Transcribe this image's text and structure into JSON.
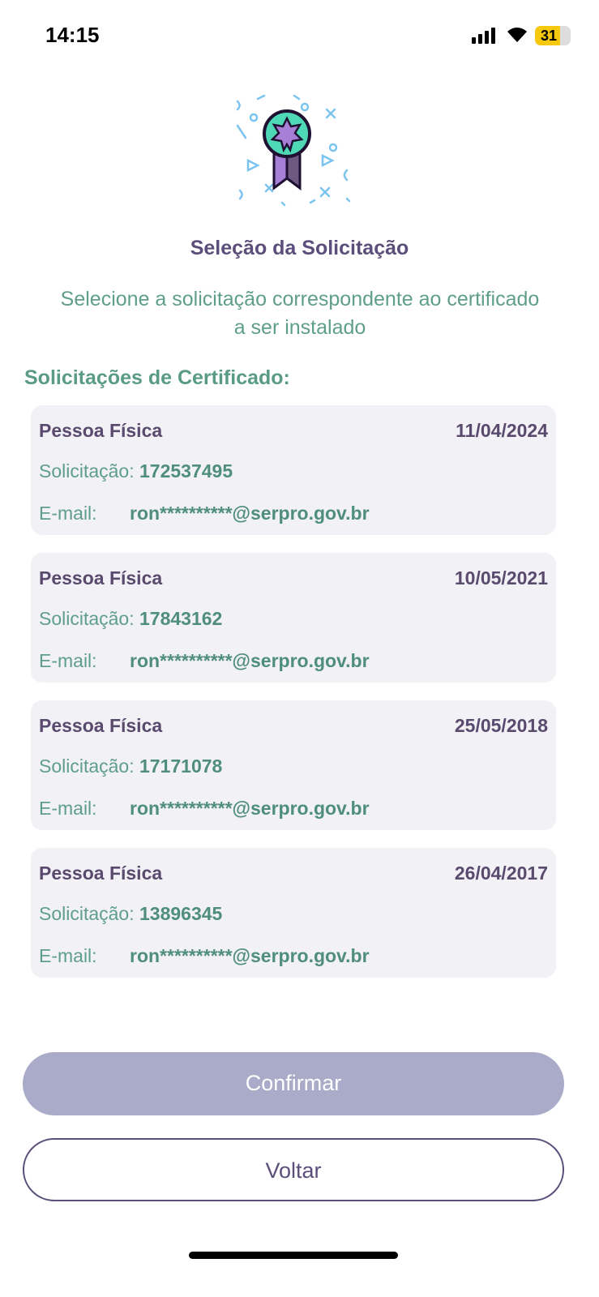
{
  "status_bar": {
    "time": "14:15",
    "battery": "31"
  },
  "header": {
    "title": "Seleção da Solicitação",
    "subtitle": "Selecione a solicitação correspondente ao certificado a ser instalado"
  },
  "section_title": "Solicitações de Certificado:",
  "labels": {
    "request": "Solicitação:",
    "email": "E-mail:"
  },
  "requests": [
    {
      "type": "Pessoa Física",
      "date": "11/04/2024",
      "number": "172537495",
      "email": "ron**********@serpro.gov.br"
    },
    {
      "type": "Pessoa Física",
      "date": "10/05/2021",
      "number": "17843162",
      "email": "ron**********@serpro.gov.br"
    },
    {
      "type": "Pessoa Física",
      "date": "25/05/2018",
      "number": "17171078",
      "email": "ron**********@serpro.gov.br"
    },
    {
      "type": "Pessoa Física",
      "date": "26/04/2017",
      "number": "13896345",
      "email": "ron**********@serpro.gov.br"
    }
  ],
  "buttons": {
    "confirm": "Confirmar",
    "back": "Voltar"
  }
}
